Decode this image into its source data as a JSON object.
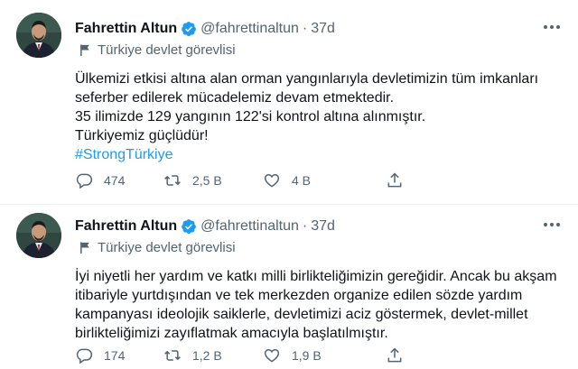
{
  "tweets": [
    {
      "author_name": "Fahrettin Altun",
      "handle": "@fahrettinaltun",
      "separator": "·",
      "time": "37d",
      "label": "Türkiye devlet görevlisi",
      "lines": [
        "Ülkemizi etkisi altına alan orman yangınlarıyla devletimizin tüm imkanları",
        "seferber edilerek mücadelemiz devam etmektedir.",
        "35 ilimizde 129 yangının 122'si kontrol altına alınmıştır.",
        "Türkiyemiz güçlüdür!"
      ],
      "hashtag": "#StrongTürkiye",
      "replies": "474",
      "retweets": "2,5 B",
      "likes": "4 B"
    },
    {
      "author_name": "Fahrettin Altun",
      "handle": "@fahrettinaltun",
      "separator": "·",
      "time": "37d",
      "label": "Türkiye devlet görevlisi",
      "lines": [
        "İyi niyetli her yardım ve katkı milli birlikteliğimizin gereğidir. Ancak bu akşam",
        "itibariyle yurtdışından ve tek merkezden organize edilen sözde yardım",
        "kampanyası ideolojik saiklerle, devletimizi aciz göstermek, devlet-millet",
        "birlikteliğimizi zayıflatmak amacıyla başlatılmıştır."
      ],
      "replies": "174",
      "retweets": "1,2 B",
      "likes": "1,9 B"
    }
  ],
  "icons": {
    "verified": "verified-badge-icon",
    "label": "flag-icon",
    "more": "more-options-icon",
    "reply": "reply-icon",
    "retweet": "retweet-icon",
    "like": "heart-icon",
    "share": "share-icon"
  },
  "colors": {
    "text": "#0f1419",
    "secondary": "#536471",
    "link": "#1d9bf0",
    "verified": "#1d9bf0",
    "divider": "#eff3f4"
  }
}
